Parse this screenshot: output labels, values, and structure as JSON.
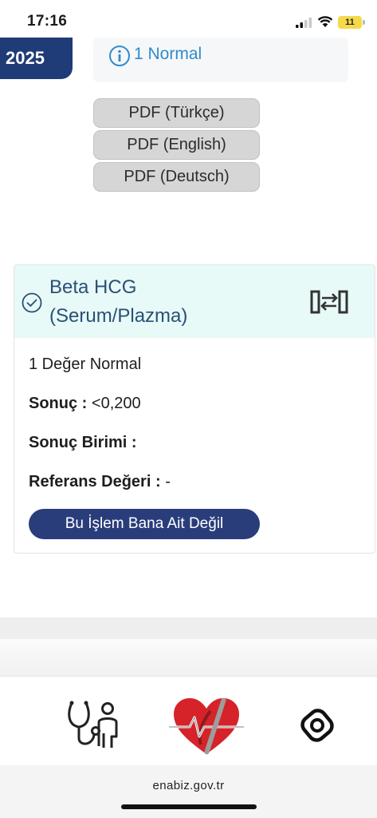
{
  "status_bar": {
    "time": "17:16",
    "battery": "11"
  },
  "record": {
    "year": "2025",
    "summary": "1 Normal",
    "pdf_buttons": [
      "PDF (Türkçe)",
      "PDF (English)",
      "PDF (Deutsch)"
    ]
  },
  "result_card": {
    "test_name_line1": "Beta HCG",
    "test_name_line2": "(Serum/Plazma)",
    "normal_count": "1 Değer Normal",
    "result_label": "Sonuç :",
    "result_value": "<0,200",
    "unit_label": "Sonuç Birimi :",
    "unit_value": "",
    "reference_label": "Referans Değeri :",
    "reference_value": "-",
    "not_mine_button": "Bu İşlem Bana Ait Değil"
  },
  "bottom_nav": {
    "items": [
      {
        "icon": "doctor-patient-icon"
      },
      {
        "icon": "heart-logo-icon"
      },
      {
        "icon": "lens-icon"
      }
    ]
  },
  "browser": {
    "url": "enabiz.gov.tr"
  },
  "colors": {
    "brand_navy": "#1f3b78",
    "accent_blue": "#2f8ccc",
    "card_header": "#e7faf8",
    "heart_red": "#d6232a"
  }
}
